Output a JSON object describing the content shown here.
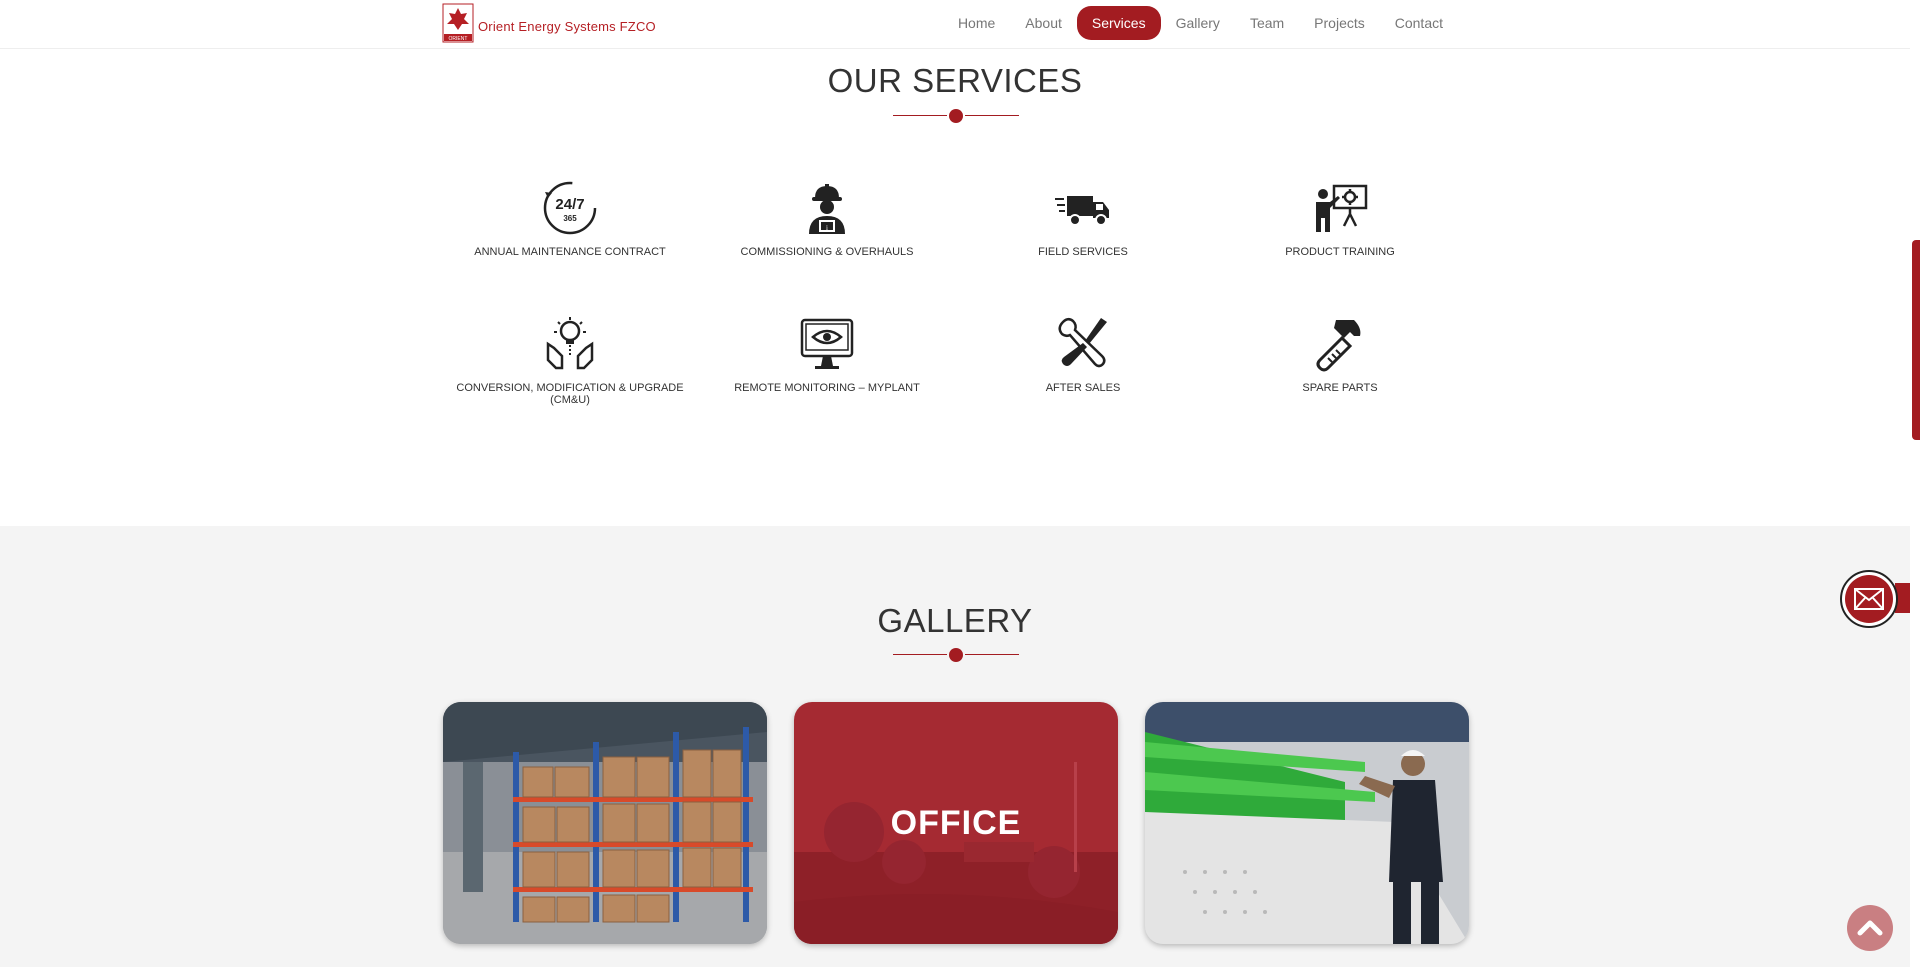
{
  "brand": {
    "name": "Orient Energy Systems FZCO",
    "logo_caption": "ORIENT"
  },
  "nav": {
    "items": [
      {
        "label": "Home"
      },
      {
        "label": "About"
      },
      {
        "label": "Services"
      },
      {
        "label": "Gallery"
      },
      {
        "label": "Team"
      },
      {
        "label": "Projects"
      },
      {
        "label": "Contact"
      }
    ],
    "active": "Services"
  },
  "services": {
    "title": "OUR SERVICES",
    "items": [
      {
        "label": "ANNUAL MAINTENANCE CONTRACT",
        "icon": "clock-24-7-icon",
        "icon_text_main": "24/7",
        "icon_text_sub": "365"
      },
      {
        "label": "COMMISSIONING & OVERHAULS",
        "icon": "engineer-icon"
      },
      {
        "label": "FIELD SERVICES",
        "icon": "delivery-truck-icon"
      },
      {
        "label": "PRODUCT TRAINING",
        "icon": "presentation-board-icon"
      },
      {
        "label": "CONVERSION, MODIFICATION & UPGRADE (CM&U)",
        "icon": "hands-lightbulb-icon"
      },
      {
        "label": "REMOTE MONITORING – MYPLANT",
        "icon": "monitor-eye-icon"
      },
      {
        "label": "AFTER SALES",
        "icon": "wrench-screwdriver-icon"
      },
      {
        "label": "SPARE PARTS",
        "icon": "hammer-icon"
      }
    ]
  },
  "gallery": {
    "title": "GALLERY",
    "cards": [
      {
        "label": "",
        "image": "warehouse-photo"
      },
      {
        "label": "OFFICE",
        "image": "office-photo"
      },
      {
        "label": "",
        "image": "engine-technician-photo"
      }
    ]
  },
  "colors": {
    "accent": "#a31c21",
    "section_bg": "#f4f4f4"
  }
}
